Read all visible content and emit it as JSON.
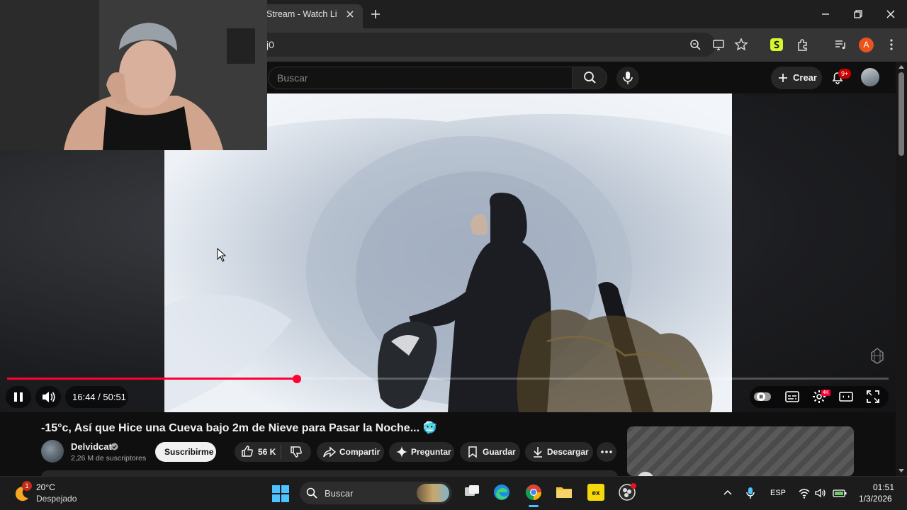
{
  "browser": {
    "tab_title": "Stream - Watch Live",
    "url_partial": "j0",
    "profile_initial": "A"
  },
  "masthead": {
    "search_placeholder": "Buscar",
    "create_label": "Crear",
    "notifications_badge": "9+"
  },
  "player": {
    "current_time": "16:44",
    "duration": "50:51",
    "time_display": "16:44 / 50:51",
    "progress_fraction": 0.329,
    "state": "playing",
    "settings_badge": "4K"
  },
  "video": {
    "title": "-15°c, Así que Hice una Cueva bajo 2m de Nieve para Pasar la Noche... 🥶",
    "channel_name": "Delvidcat",
    "subscribers": "2,26 M de suscriptores",
    "subscribe_label": "Suscribirme",
    "likes": "56 K",
    "share_label": "Compartir",
    "ask_label": "Preguntar",
    "save_label": "Guardar",
    "download_label": "Descargar"
  },
  "taskbar": {
    "weather_temp": "20°C",
    "weather_desc": "Despejado",
    "weather_badge": "1",
    "search_label": "Buscar",
    "language": "ESP",
    "time": "01:51",
    "date": "1/3/2026"
  },
  "colors": {
    "progress": "#ff0033",
    "background": "#0f0f0f",
    "pill": "#272727"
  }
}
